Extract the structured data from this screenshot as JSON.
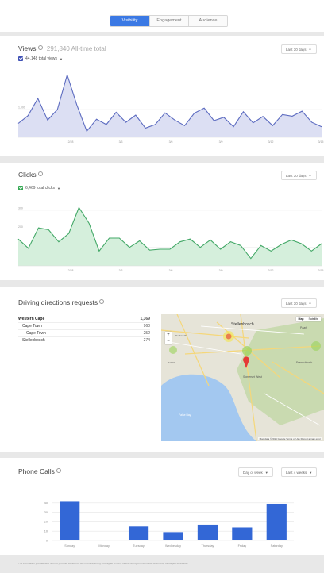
{
  "tabs": [
    {
      "label": "Visibility",
      "active": true
    },
    {
      "label": "Engagement",
      "active": false
    },
    {
      "label": "Audience",
      "active": false
    }
  ],
  "views": {
    "title": "Views",
    "subtitle": "291,840 All-time total",
    "range": "Last 30 days",
    "metric": "44,148 total views",
    "color": "#3f51b5"
  },
  "clicks": {
    "title": "Clicks",
    "range": "Last 30 days",
    "metric": "6,469 total clicks",
    "color": "#34a853"
  },
  "directions": {
    "title": "Driving directions requests",
    "range": "Last 30 days",
    "rows": [
      {
        "name": "Western Cape",
        "value": "1,369",
        "level": 0
      },
      {
        "name": "Cape Town",
        "value": "960",
        "level": 1
      },
      {
        "name": "Cape Town",
        "value": "252",
        "level": 2
      },
      {
        "name": "Stellenbosch",
        "value": "274",
        "level": 1
      }
    ],
    "map": {
      "toggle_map": "Map",
      "toggle_satellite": "Satellite",
      "zoom_in": "+",
      "zoom_out": "−",
      "labels": [
        "Stellenbosch",
        "Paarl",
        "Franschhoek",
        "Somerset West",
        "False Bay",
        "Durbanville",
        "Bellville"
      ],
      "footer": "Map data ©2016 Google   Terms of Use   Report a map error"
    }
  },
  "phone": {
    "title": "Phone Calls",
    "group_by": "Day of week",
    "range": "Last 4 weeks"
  },
  "chart_data": [
    {
      "type": "area",
      "name": "views",
      "x_tick_labels": [
        "2/28",
        "3/3",
        "3/6",
        "3/9",
        "3/12",
        "3/15"
      ],
      "y_tick_labels": [
        "1,000"
      ],
      "ylim": [
        0,
        2400
      ],
      "values": [
        500,
        780,
        1400,
        620,
        1000,
        2250,
        1150,
        220,
        650,
        460,
        900,
        540,
        800,
        330,
        460,
        880,
        620,
        420,
        870,
        1050,
        600,
        720,
        380,
        920,
        520,
        750,
        420,
        820,
        760,
        940,
        540,
        380
      ]
    },
    {
      "type": "area",
      "name": "clicks",
      "x_tick_labels": [
        "2/28",
        "3/3",
        "3/6",
        "3/9",
        "3/12",
        "3/15"
      ],
      "y_tick_labels": [
        "300",
        "200",
        "100"
      ],
      "ylim": [
        0,
        360
      ],
      "values": [
        145,
        95,
        205,
        195,
        130,
        175,
        315,
        230,
        80,
        150,
        150,
        100,
        135,
        85,
        90,
        90,
        130,
        145,
        100,
        140,
        90,
        130,
        110,
        40,
        110,
        80,
        115,
        140,
        120,
        80,
        120
      ]
    },
    {
      "type": "bar",
      "name": "phone_calls",
      "categories": [
        "Sunday",
        "Monday",
        "Tuesday",
        "Wednesday",
        "Thursday",
        "Friday",
        "Saturday"
      ],
      "values": [
        42,
        0,
        15,
        9,
        17,
        14,
        39
      ],
      "ylim": [
        0,
        50
      ],
      "y_ticks": [
        0,
        10,
        20,
        30,
        40
      ],
      "color": "#3367d6"
    }
  ],
  "footnote": "The information you see here has not yet been verified for use in this reporting. You agree to verify before relying on information which may be subject to revision."
}
